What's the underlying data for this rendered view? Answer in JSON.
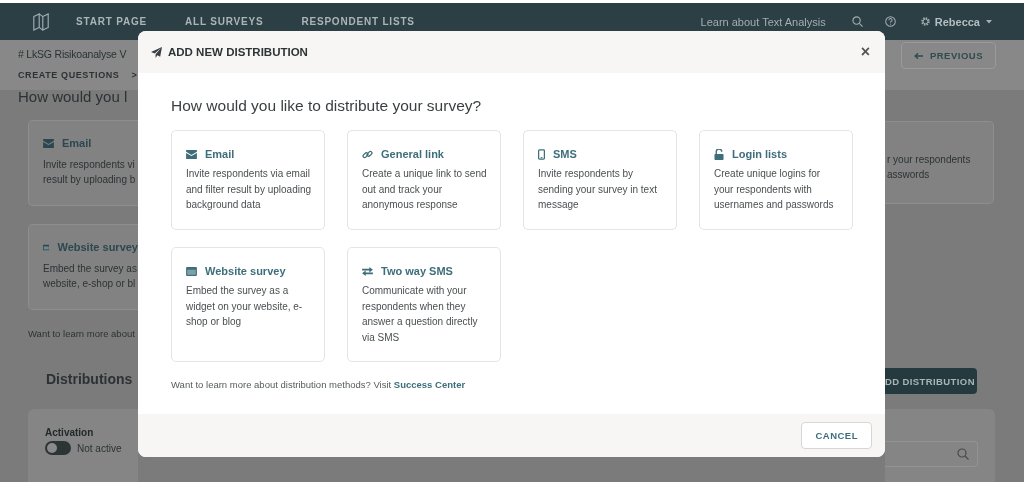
{
  "nav": {
    "items": [
      {
        "label": "START PAGE"
      },
      {
        "label": "ALL SURVEYS"
      },
      {
        "label": "RESPONDENT LISTS"
      }
    ],
    "learn_link": "Learn about Text Analysis",
    "user": "Rebecca"
  },
  "page": {
    "title": "# LkSG Risikoanalyse V",
    "breadcrumb": "CREATE QUESTIONS",
    "breadcrumb_separator": ">",
    "previous_button": "PREVIOUS",
    "question": "How would you l",
    "left_cards": [
      {
        "kind": "email",
        "title": "Email",
        "lines": [
          "Invite respondents vi",
          "result by uploading b"
        ]
      },
      {
        "kind": "website",
        "title": "Website survey",
        "lines": [
          "Embed the survey as",
          "website, e-shop or bl"
        ]
      }
    ],
    "right_card_lines": [
      "r your respondents",
      "asswords"
    ],
    "learn_more": "Want to learn more about",
    "distributions_heading": "Distributions",
    "add_button": "DD DISTRIBUTION",
    "activation": {
      "label": "Activation",
      "on": false,
      "state_text": "Not active"
    }
  },
  "modal": {
    "title": "ADD NEW DISTRIBUTION",
    "close": "×",
    "question": "How would you like to distribute your survey?",
    "methods": [
      {
        "kind": "email",
        "title": "Email",
        "description": "Invite respondents via email and filter result by uploading background data"
      },
      {
        "kind": "link",
        "title": "General link",
        "description": "Create a unique link to send out and track your anonymous response"
      },
      {
        "kind": "sms",
        "title": "SMS",
        "description": "Invite respondents by sending your survey in text message"
      },
      {
        "kind": "login",
        "title": "Login lists",
        "description": "Create unique logins for your respondents with usernames and passwords"
      },
      {
        "kind": "website",
        "title": "Website survey",
        "description": "Embed the survey as a widget on your website, e-shop or blog"
      },
      {
        "kind": "two_way_sms",
        "title": "Two way SMS",
        "description": "Communicate with your respondents when they answer a question directly via SMS"
      }
    ],
    "footer_text": "Want to learn more about distribution methods? Visit ",
    "footer_link": "Success Center",
    "cancel": "CANCEL"
  }
}
